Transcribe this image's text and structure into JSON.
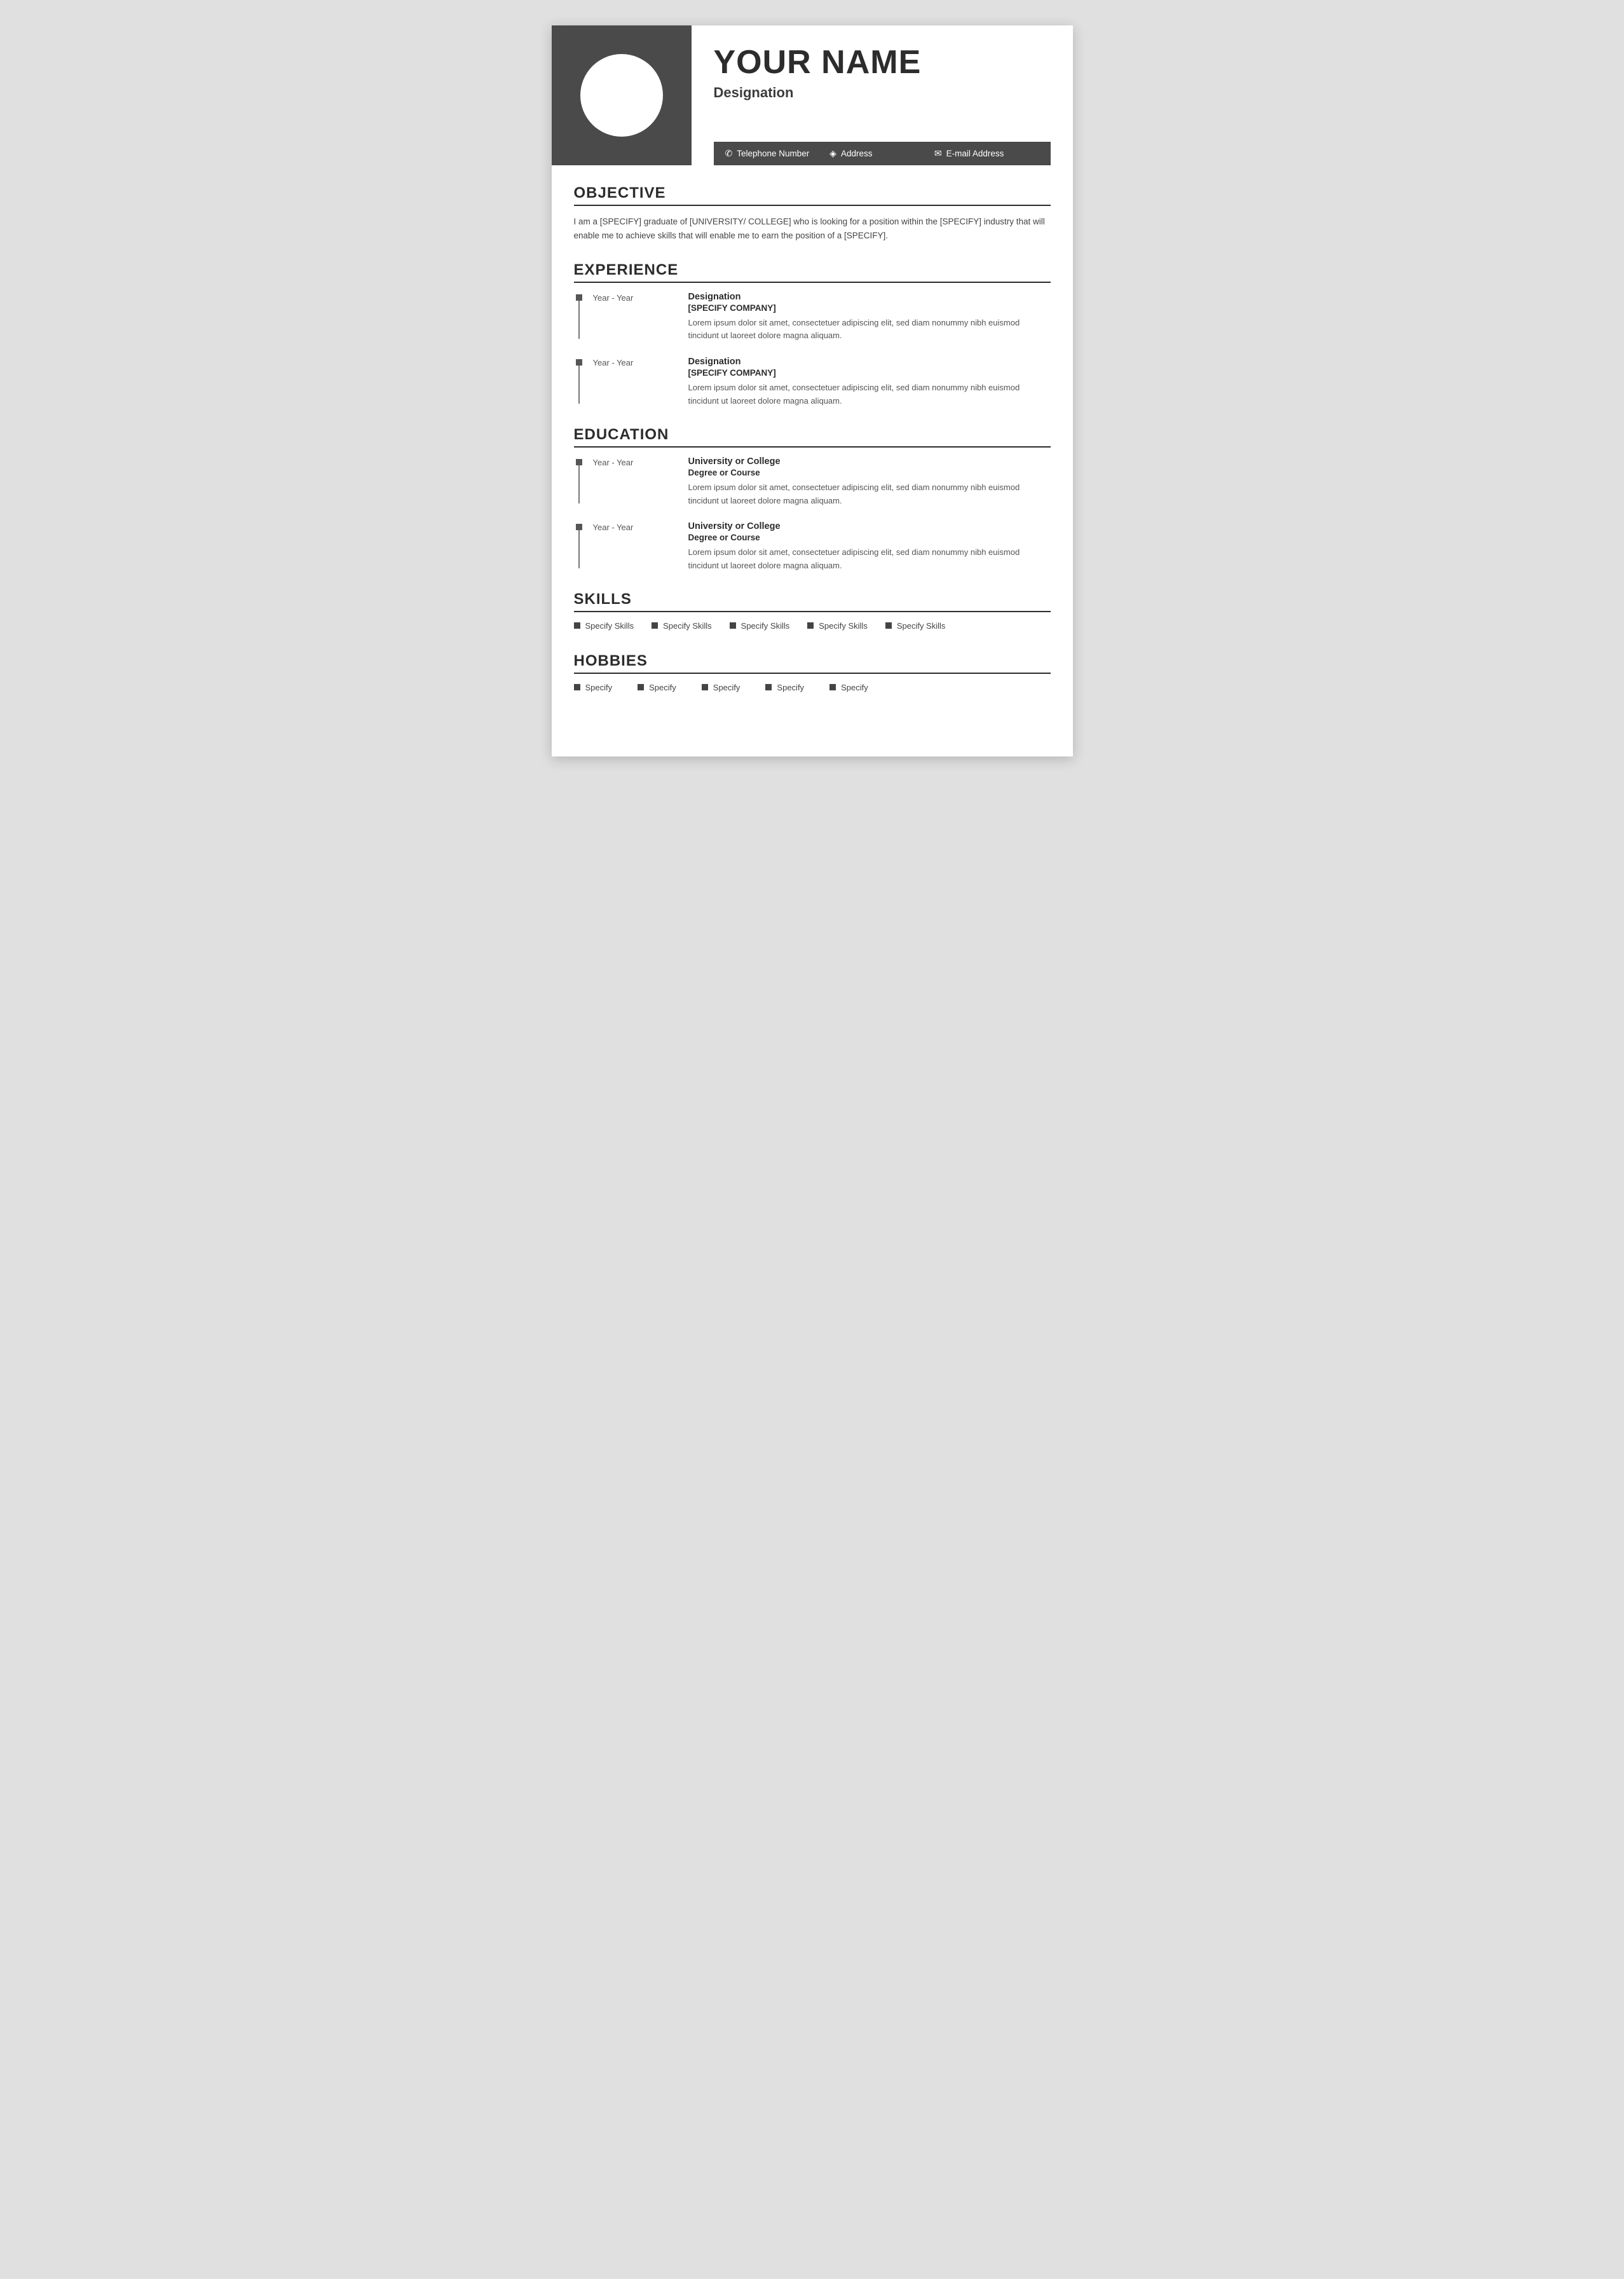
{
  "header": {
    "name": "YOUR NAME",
    "designation": "Designation",
    "contact": {
      "phone": "Telephone Number",
      "address": "Address",
      "email": "E-mail Address"
    }
  },
  "objective": {
    "section_title": "OBJECTIVE",
    "text": "I am a [SPECIFY] graduate of [UNIVERSITY/ COLLEGE] who is looking for a position within the [SPECIFY] industry that will enable me to achieve skills that will enable me to earn the position of a [SPECIFY]."
  },
  "experience": {
    "section_title": "EXPERIENCE",
    "items": [
      {
        "years": "Year - Year",
        "role": "Designation",
        "company": "[SPECIFY COMPANY]",
        "desc": "Lorem ipsum dolor sit amet, consectetuer adipiscing elit, sed diam nonummy nibh euismod tincidunt ut laoreet dolore magna aliquam."
      },
      {
        "years": "Year - Year",
        "role": "Designation",
        "company": "[SPECIFY COMPANY]",
        "desc": "Lorem ipsum dolor sit amet, consectetuer adipiscing elit, sed diam nonummy nibh euismod tincidunt ut laoreet dolore magna aliquam."
      }
    ]
  },
  "education": {
    "section_title": "EDUCATION",
    "items": [
      {
        "years": "Year - Year",
        "university": "University or College",
        "degree": "Degree or Course",
        "desc": "Lorem ipsum dolor sit amet, consectetuer adipiscing elit, sed diam nonummy nibh euismod tincidunt ut laoreet dolore magna aliquam."
      },
      {
        "years": "Year - Year",
        "university": "University or College",
        "degree": "Degree or Course",
        "desc": "Lorem ipsum dolor sit amet, consectetuer adipiscing elit, sed diam nonummy nibh euismod tincidunt ut laoreet dolore magna aliquam."
      }
    ]
  },
  "skills": {
    "section_title": "SKILLS",
    "items": [
      "Specify Skills",
      "Specify Skills",
      "Specify Skills",
      "Specify Skills",
      "Specify Skills"
    ]
  },
  "hobbies": {
    "section_title": "HOBBIES",
    "items": [
      "Specify",
      "Specify",
      "Specify",
      "Specify",
      "Specify"
    ]
  },
  "icons": {
    "phone": "✆",
    "location": "♦",
    "email": "✉"
  },
  "colors": {
    "dark": "#4a4a4a",
    "white": "#ffffff",
    "text_dark": "#2c2c2c",
    "text_mid": "#444444",
    "text_light": "#555555"
  }
}
